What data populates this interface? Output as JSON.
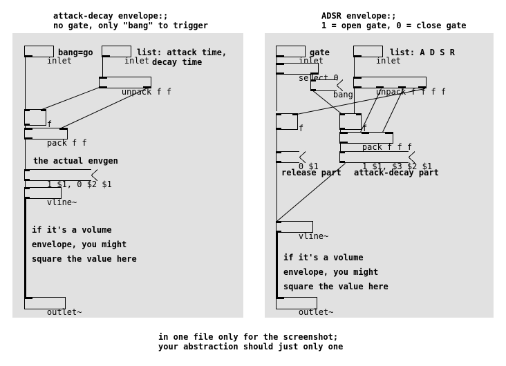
{
  "canvas": {
    "background": "#ffffff",
    "panel_color": "#e1e1e1",
    "line_color": "#000000"
  },
  "left_patch": {
    "title_line1": "attack-decay envelope:;",
    "title_line2": "no gate, only \"bang\" to trigger",
    "objects": {
      "inlet_bang": "inlet",
      "inlet_bang_comment": "bang=go",
      "inlet_list": "inlet",
      "inlet_list_comment_line1": "list: attack time,",
      "inlet_list_comment_line2": "decay time",
      "unpack": "unpack f f",
      "float": "f",
      "pack": "pack f f",
      "envgen_comment": "the actual envgen",
      "message": "1 $1, 0 $2 $1",
      "vline": "vline~",
      "note_line1": "if it's a volume",
      "note_line2": "envelope, you might",
      "note_line3": "square the value here",
      "outlet": "outlet~"
    }
  },
  "right_patch": {
    "title_line1": "ADSR envelope:;",
    "title_line2": "1 = open gate, 0 = close gate",
    "objects": {
      "inlet_gate": "inlet",
      "inlet_gate_comment": "gate",
      "inlet_list": "inlet",
      "inlet_list_comment": "list: A D S R",
      "select": "select 0",
      "bang_message": "bang",
      "unpack": "unpack f f f f",
      "float_left": "f",
      "float_right": "f",
      "pack": "pack f f f",
      "message_release": "0 $1",
      "message_attack": "1 $1, $3 $2 $1",
      "release_label": "release part",
      "attack_decay_label": "attack-decay part",
      "vline": "vline~",
      "note_line1": "if it's a volume",
      "note_line2": "envelope, you might",
      "note_line3": "square the value here",
      "outlet": "outlet~"
    }
  },
  "footer": {
    "line1": "in one file only for the screenshot;",
    "line2": "your abstraction should just only one"
  }
}
